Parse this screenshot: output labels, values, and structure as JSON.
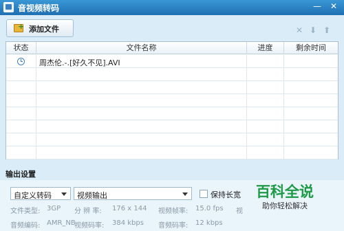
{
  "window": {
    "title": "音视频转码",
    "minimize_icon": "minimize-icon",
    "close_icon": "close-icon"
  },
  "toolbar": {
    "add_label": "添加文件",
    "icons": [
      "delete-icon",
      "move-down-icon",
      "move-up-icon"
    ]
  },
  "table": {
    "columns": [
      "状态",
      "文件名称",
      "进度",
      "剩余时间"
    ],
    "rows": [
      {
        "status_icon": "clock-icon",
        "name": "周杰伦.-.[好久不见].AVI",
        "progress": "",
        "remaining": ""
      }
    ]
  },
  "output": {
    "section_title": "输出设置",
    "mode_select": "自定义转码",
    "output_select": "视频输出",
    "keep_ratio_label": "保持长宽",
    "info_row1": {
      "format_label": "文件类型:",
      "format_value": "3GP",
      "res_label": "分 辨 率:",
      "res_value": "176 x 144",
      "fps_label": "视频帧率:",
      "fps_value": "15.0 fps",
      "trailing": "视"
    },
    "info_row2": {
      "acodec_label": "音频编码:",
      "acodec_value": "AMR_NB",
      "vbit_label": "视频码率:",
      "vbit_value": "384 kbps",
      "abit_label": "音频码率:",
      "abit_value": "12 kbps"
    }
  },
  "watermark": {
    "title": "百科全说",
    "subtitle": "助你轻松解决"
  },
  "colors": {
    "titlebar": "#2a82c6",
    "panel": "#d9ecf7",
    "watermark_green": "#1d9a45"
  }
}
